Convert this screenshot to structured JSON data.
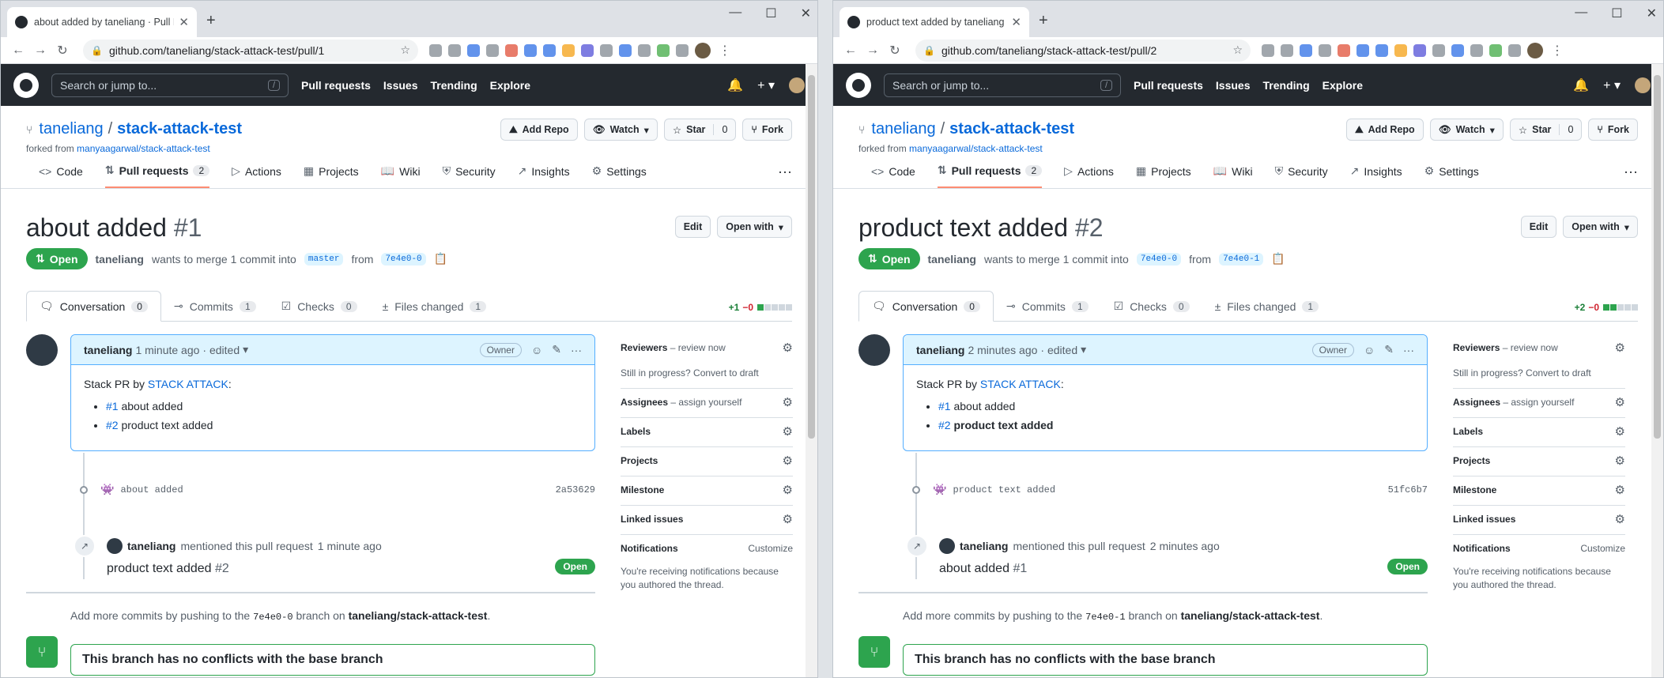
{
  "common": {
    "gh": {
      "search_placeholder": "Search or jump to...",
      "slash": "/",
      "nav": [
        "Pull requests",
        "Issues",
        "Trending",
        "Explore"
      ]
    },
    "repo": {
      "owner": "taneliang",
      "sep": "/",
      "name": "stack-attack-test",
      "forked_prefix": "forked from",
      "forked_link": "manyaagarwal/stack-attack-test",
      "add_repo": "Add Repo",
      "watch": "Watch",
      "star": "Star",
      "star_count": "0",
      "fork": "Fork",
      "tabs": {
        "code": "Code",
        "pulls": "Pull requests",
        "pulls_count": "2",
        "actions": "Actions",
        "projects": "Projects",
        "wiki": "Wiki",
        "security": "Security",
        "insights": "Insights",
        "settings": "Settings",
        "more": "···"
      }
    },
    "pr": {
      "edit": "Edit",
      "open_with": "Open with",
      "state": "Open",
      "author": "taneliang",
      "merge_text": "wants to merge 1 commit into",
      "from": "from",
      "tabs": {
        "conversation": "Conversation",
        "conversation_count": "0",
        "commits": "Commits",
        "commits_count": "1",
        "checks": "Checks",
        "checks_count": "0",
        "files": "Files changed",
        "files_count": "1"
      },
      "del": "−0",
      "comment": {
        "author": "taneliang",
        "edited": "· edited",
        "owner": "Owner",
        "body_prefix": "Stack PR by",
        "body_link": "STACK ATTACK",
        "body_suffix": ":",
        "items": [
          {
            "num": "#1",
            "title": "about added"
          },
          {
            "num": "#2",
            "title": "product text added"
          }
        ]
      },
      "mentioned_user": "taneliang",
      "mentioned_text": "mentioned this pull request",
      "ref_state": "Open",
      "add_commits_prefix": "Add more commits by pushing to the",
      "add_commits_mid": "branch on",
      "add_commits_repo": "taneliang/stack-attack-test",
      "merge_box": "This branch has no conflicts with the base branch"
    },
    "sidebar": {
      "reviewers": "Reviewers",
      "reviewers_sub": "– review now",
      "draft": "Still in progress? Convert to draft",
      "assignees": "Assignees",
      "assignees_sub": "– assign yourself",
      "labels": "Labels",
      "projects": "Projects",
      "milestone": "Milestone",
      "linked": "Linked issues",
      "notifications": "Notifications",
      "customize": "Customize",
      "notif_text": "You're receiving notifications because you authored the thread."
    }
  },
  "left": {
    "tab_title": "about added by taneliang · Pull R",
    "url": "github.com/taneliang/stack-attack-test/pull/1",
    "pr_title": "about added",
    "pr_num": "#1",
    "base": "master",
    "head": "7e4e0-0",
    "add": "+1",
    "comment_time": "1 minute ago",
    "commit_msg": "about added",
    "commit_sha": "2a53629",
    "mention_time": "1 minute ago",
    "ref_title": "product text added",
    "ref_num": "#2",
    "branch": "7e4e0-0"
  },
  "right": {
    "tab_title": "product text added by taneliang",
    "url": "github.com/taneliang/stack-attack-test/pull/2",
    "pr_title": "product text added",
    "pr_num": "#2",
    "base": "7e4e0-0",
    "head": "7e4e0-1",
    "add": "+2",
    "comment_time": "2 minutes ago",
    "commit_msg": "product text added",
    "commit_sha": "51fc6b7",
    "mention_time": "2 minutes ago",
    "ref_title": "about added",
    "ref_num": "#1",
    "branch": "7e4e0-1"
  }
}
